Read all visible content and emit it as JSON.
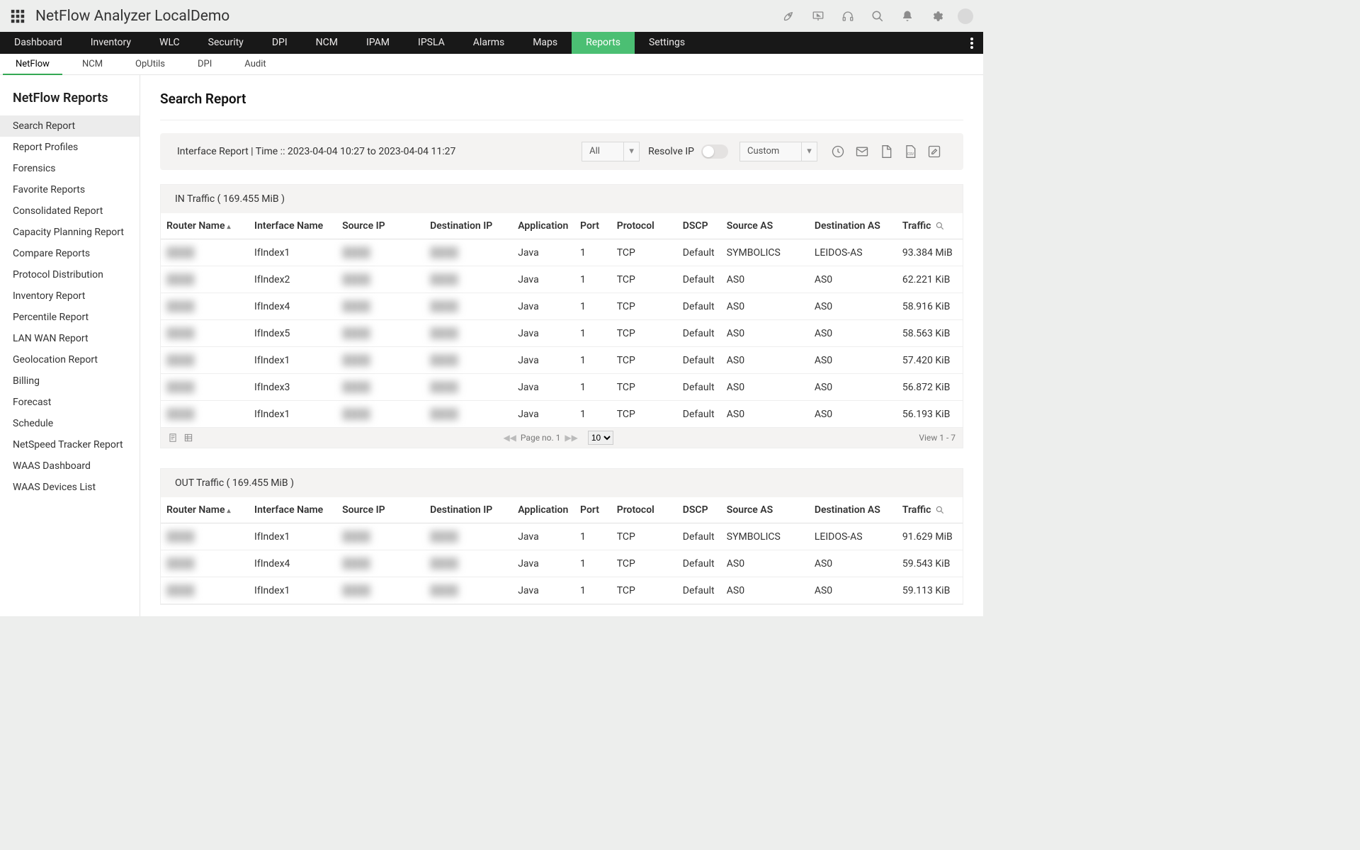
{
  "header": {
    "product_title": "NetFlow Analyzer LocalDemo"
  },
  "mainnav": {
    "items": [
      {
        "label": "Dashboard"
      },
      {
        "label": "Inventory"
      },
      {
        "label": "WLC"
      },
      {
        "label": "Security"
      },
      {
        "label": "DPI"
      },
      {
        "label": "NCM"
      },
      {
        "label": "IPAM"
      },
      {
        "label": "IPSLA"
      },
      {
        "label": "Alarms"
      },
      {
        "label": "Maps"
      },
      {
        "label": "Reports",
        "active": true
      },
      {
        "label": "Settings"
      }
    ]
  },
  "subnav": {
    "items": [
      {
        "label": "NetFlow",
        "active": true
      },
      {
        "label": "NCM"
      },
      {
        "label": "OpUtils"
      },
      {
        "label": "DPI"
      },
      {
        "label": "Audit"
      }
    ]
  },
  "sidebar": {
    "title": "NetFlow Reports",
    "items": [
      {
        "label": "Search Report",
        "active": true
      },
      {
        "label": "Report Profiles"
      },
      {
        "label": "Forensics"
      },
      {
        "label": "Favorite Reports"
      },
      {
        "label": "Consolidated Report"
      },
      {
        "label": "Capacity Planning Report"
      },
      {
        "label": "Compare Reports"
      },
      {
        "label": "Protocol Distribution"
      },
      {
        "label": "Inventory Report"
      },
      {
        "label": "Percentile Report"
      },
      {
        "label": "LAN WAN Report"
      },
      {
        "label": "Geolocation Report"
      },
      {
        "label": "Billing"
      },
      {
        "label": "Forecast"
      },
      {
        "label": "Schedule"
      },
      {
        "label": "NetSpeed Tracker Report"
      },
      {
        "label": "WAAS Dashboard"
      },
      {
        "label": "WAAS Devices List"
      }
    ]
  },
  "page": {
    "title": "Search Report",
    "filter_info": "Interface Report | Time :: 2023-04-04 10:27 to 2023-04-04 11:27",
    "scope_select": "All",
    "resolve_label": "Resolve IP",
    "time_select": "Custom"
  },
  "columns": {
    "router": "Router Name",
    "iface": "Interface Name",
    "src": "Source IP",
    "dst": "Destination IP",
    "app": "Application",
    "port": "Port",
    "proto": "Protocol",
    "dscp": "DSCP",
    "sas": "Source AS",
    "das": "Destination AS",
    "traf": "Traffic"
  },
  "sections": [
    {
      "heading": "IN Traffic ( 169.455 MiB )",
      "rows": [
        {
          "if": "IfIndex1",
          "app": "Java",
          "port": "1",
          "proto": "TCP",
          "dscp": "Default",
          "sas": "SYMBOLICS",
          "das": "LEIDOS-AS",
          "traf": "93.384 MiB"
        },
        {
          "if": "IfIndex2",
          "app": "Java",
          "port": "1",
          "proto": "TCP",
          "dscp": "Default",
          "sas": "AS0",
          "das": "AS0",
          "traf": "62.221 KiB"
        },
        {
          "if": "IfIndex4",
          "app": "Java",
          "port": "1",
          "proto": "TCP",
          "dscp": "Default",
          "sas": "AS0",
          "das": "AS0",
          "traf": "58.916 KiB"
        },
        {
          "if": "IfIndex5",
          "app": "Java",
          "port": "1",
          "proto": "TCP",
          "dscp": "Default",
          "sas": "AS0",
          "das": "AS0",
          "traf": "58.563 KiB"
        },
        {
          "if": "IfIndex1",
          "app": "Java",
          "port": "1",
          "proto": "TCP",
          "dscp": "Default",
          "sas": "AS0",
          "das": "AS0",
          "traf": "57.420 KiB"
        },
        {
          "if": "IfIndex3",
          "app": "Java",
          "port": "1",
          "proto": "TCP",
          "dscp": "Default",
          "sas": "AS0",
          "das": "AS0",
          "traf": "56.872 KiB"
        },
        {
          "if": "IfIndex1",
          "app": "Java",
          "port": "1",
          "proto": "TCP",
          "dscp": "Default",
          "sas": "AS0",
          "das": "AS0",
          "traf": "56.193 KiB"
        }
      ],
      "pager": {
        "page_label": "Page no.",
        "page": "1",
        "size": "10",
        "view": "View 1 - 7"
      }
    },
    {
      "heading": "OUT Traffic ( 169.455 MiB )",
      "rows": [
        {
          "if": "IfIndex1",
          "app": "Java",
          "port": "1",
          "proto": "TCP",
          "dscp": "Default",
          "sas": "SYMBOLICS",
          "das": "LEIDOS-AS",
          "traf": "91.629 MiB"
        },
        {
          "if": "IfIndex4",
          "app": "Java",
          "port": "1",
          "proto": "TCP",
          "dscp": "Default",
          "sas": "AS0",
          "das": "AS0",
          "traf": "59.543 KiB"
        },
        {
          "if": "IfIndex1",
          "app": "Java",
          "port": "1",
          "proto": "TCP",
          "dscp": "Default",
          "sas": "AS0",
          "das": "AS0",
          "traf": "59.113 KiB"
        }
      ]
    }
  ]
}
